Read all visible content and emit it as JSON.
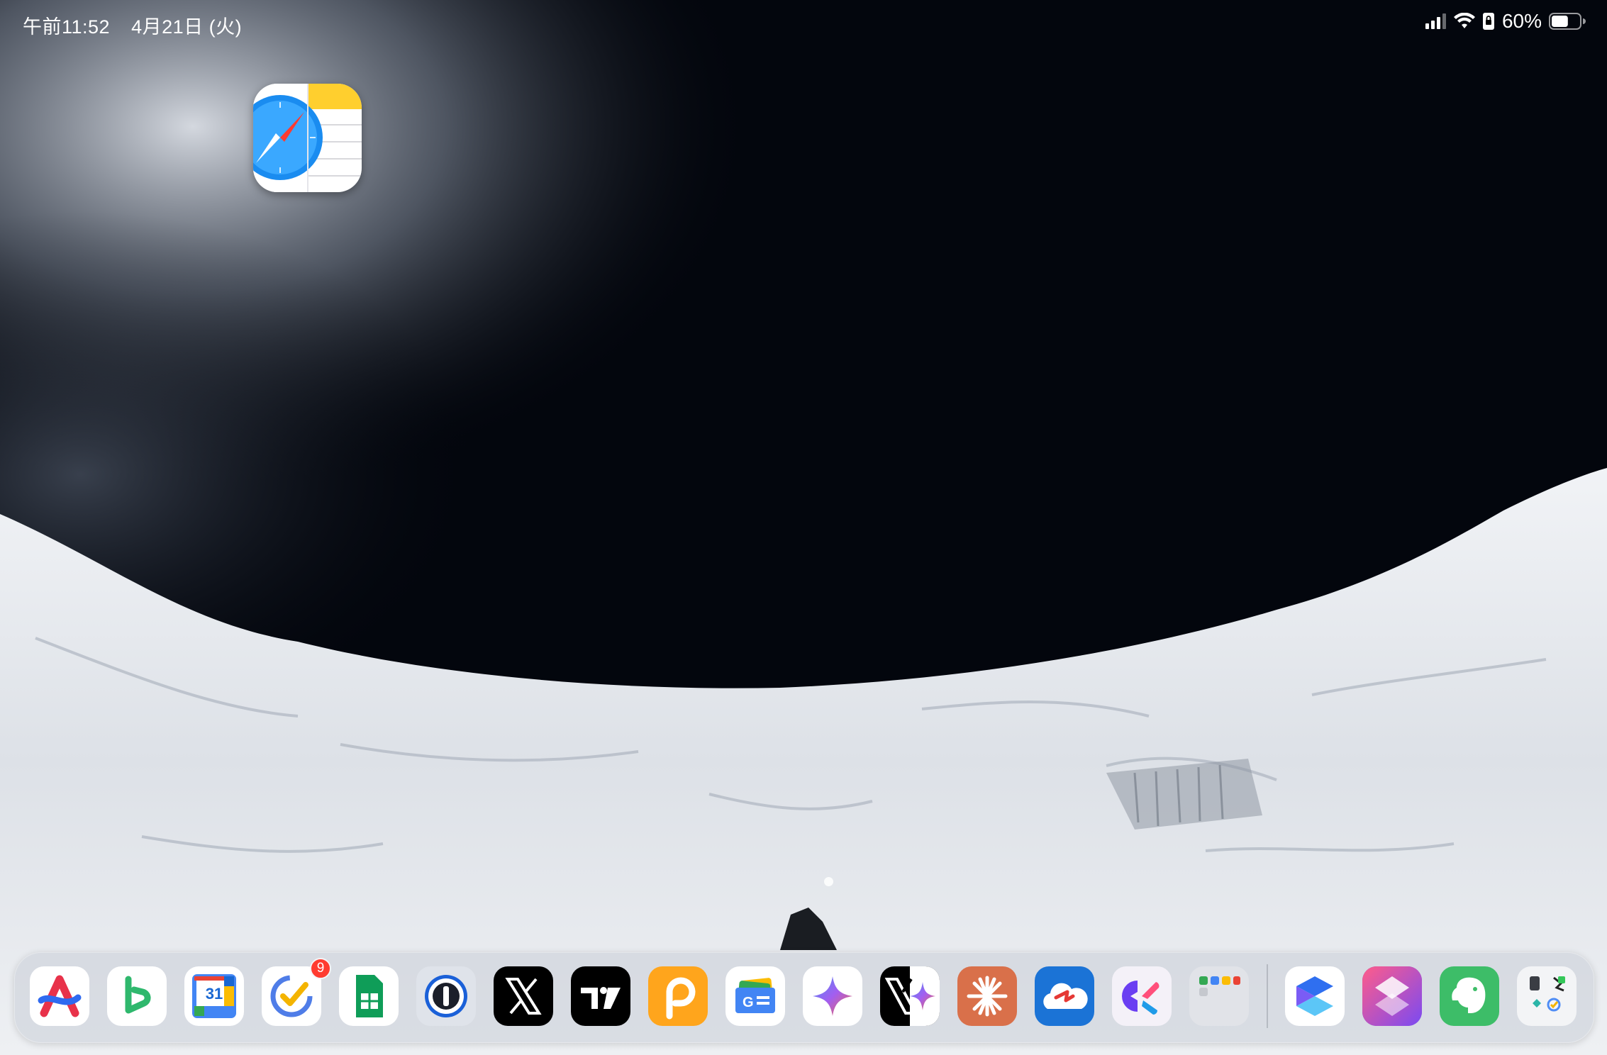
{
  "status_bar": {
    "time": "午前11:52",
    "date": "4月21日 (火)",
    "battery_percent": "60%",
    "battery_level": 0.6,
    "icons": [
      "cellular-signal-icon",
      "wifi-icon",
      "orientation-lock-icon",
      "battery-icon"
    ]
  },
  "home_screen": {
    "apps": [
      {
        "icon": "safari-notes-stack-icon"
      }
    ],
    "page_count": 1,
    "current_page": 1
  },
  "dock": {
    "apps": [
      {
        "icon": "arc-search-icon",
        "color": "#ffffff"
      },
      {
        "icon": "bing-icon",
        "color": "#ffffff"
      },
      {
        "icon": "google-calendar-icon",
        "label": "31",
        "color": "#ffffff"
      },
      {
        "icon": "tasks-check-icon",
        "badge": "9",
        "color": "#ffffff"
      },
      {
        "icon": "google-sheets-icon",
        "color": "#ffffff"
      },
      {
        "icon": "onepassword-icon",
        "color": "#dfe3ea"
      },
      {
        "icon": "x-icon",
        "color": "#000000"
      },
      {
        "icon": "tradingview-icon",
        "color": "#000000"
      },
      {
        "icon": "p-app-icon",
        "color": "#ffa51c"
      },
      {
        "icon": "google-news-icon",
        "color": "#ffffff"
      },
      {
        "icon": "gemini-icon",
        "color": "#ffffff"
      },
      {
        "icon": "x-gemini-icon",
        "color": "#000000"
      },
      {
        "icon": "claude-icon",
        "color": "#d9704a"
      },
      {
        "icon": "weather-cloud-icon",
        "color": "#1b73d6"
      },
      {
        "icon": "clockify-icon",
        "color": "#f4f1f8"
      },
      {
        "icon": "app-folder-icon",
        "color": "#e1e3e8"
      },
      {
        "icon": "smart-s-icon",
        "color": "#ffffff"
      },
      {
        "icon": "shortcuts-icon",
        "color": "#5a2fc9"
      },
      {
        "icon": "evernote-icon",
        "color": "#3dbd68"
      },
      {
        "icon": "utilities-folder-icon",
        "color": "#f3f4f6"
      }
    ]
  }
}
